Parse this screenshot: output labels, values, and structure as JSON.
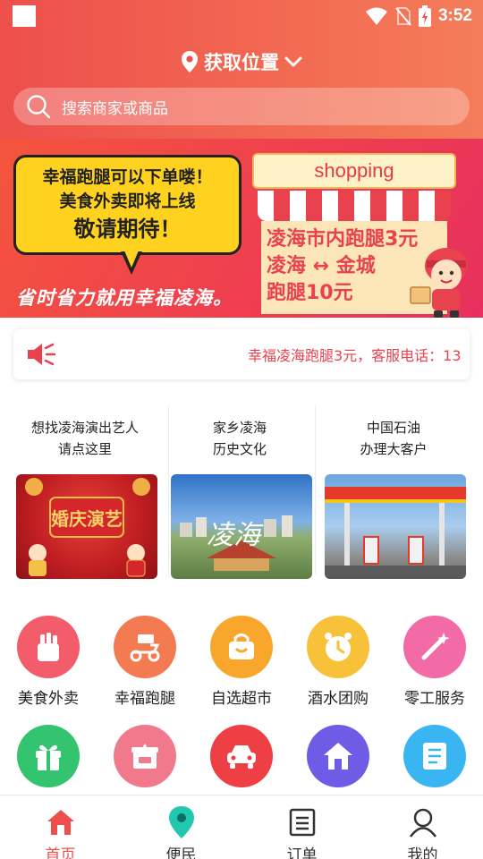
{
  "status_bar": {
    "time": "3:52"
  },
  "header": {
    "location_label": "获取位置",
    "search_placeholder": "搜索商家或商品"
  },
  "banner": {
    "bubble_lines": [
      "幸福跑腿可以下单喽！",
      "美食外卖即将上线",
      "敬请期待！"
    ],
    "slogan": "省时省力就用幸福凌海。",
    "shop_sign": "shopping",
    "shop_lines": [
      "凌海市内跑腿3元",
      "凌海 ↔ 金城",
      "跑腿10元"
    ]
  },
  "notice": {
    "text": "幸福凌海跑腿3元，客服电话：13"
  },
  "features": [
    {
      "title_lines": [
        "想找凌海演出艺人",
        "请点这里"
      ],
      "image_text": "婚庆演艺"
    },
    {
      "title_lines": [
        "家乡凌海",
        "历史文化"
      ],
      "image_text": "凌海"
    },
    {
      "title_lines": [
        "中国石油",
        "办理大客户"
      ],
      "image_text": ""
    }
  ],
  "services_row1": [
    {
      "label": "美食外卖",
      "icon": "fries-icon",
      "color": "#f35d6b"
    },
    {
      "label": "幸福跑腿",
      "icon": "scooter-icon",
      "color": "#f47a52"
    },
    {
      "label": "自选超市",
      "icon": "basket-icon",
      "color": "#f9a72c"
    },
    {
      "label": "酒水团购",
      "icon": "clock-icon",
      "color": "#f7c23a"
    },
    {
      "label": "零工服务",
      "icon": "magic-wand-icon",
      "color": "#f26aa6"
    }
  ],
  "services_row2": [
    {
      "label": "",
      "icon": "gift-icon",
      "color": "#34c36f"
    },
    {
      "label": "",
      "icon": "secondhand-box-icon",
      "color": "#f07a8c"
    },
    {
      "label": "",
      "icon": "car-icon",
      "color": "#ee3f45"
    },
    {
      "label": "",
      "icon": "house-icon",
      "color": "#6e5ce6"
    },
    {
      "label": "",
      "icon": "checklist-icon",
      "color": "#39b6f2"
    }
  ],
  "tabs": [
    {
      "label": "首页",
      "icon": "home-icon",
      "active": true
    },
    {
      "label": "便民",
      "icon": "map-pin-icon",
      "active": false
    },
    {
      "label": "订单",
      "icon": "order-list-icon",
      "active": false
    },
    {
      "label": "我的",
      "icon": "user-icon",
      "active": false
    }
  ],
  "colors": {
    "primary": "#ee4f4c",
    "notice_text": "#e8424f"
  }
}
